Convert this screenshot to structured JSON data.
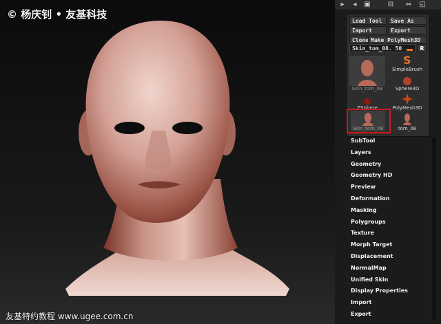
{
  "watermark": {
    "top": "© 杨庆钊 • 友基科技",
    "bottom": "友基特约教程 www.ugee.com.cn"
  },
  "toolbar_icons": [
    "toolbar-icon-a",
    "toolbar-icon-b",
    "toolbar-icon-c",
    "toolbar-icon-d",
    "toolbar-icon-e",
    "toolbar-icon-f"
  ],
  "tool_panel": {
    "buttons": {
      "load_tool": "Load Tool",
      "save_as": "Save As",
      "import": "Import",
      "export": "Export",
      "clone": "Clone",
      "make_polymesh": "Make PolyMesh3D"
    },
    "slider": {
      "label": "Skin_tom_08. 50",
      "level": 0.5
    },
    "r_label": "R",
    "thumbnails": [
      {
        "label": "Skin_tom_08"
      },
      {
        "label": "SimpleBrush"
      },
      {
        "label": "Sphere3D"
      },
      {
        "label": "ZSphere"
      },
      {
        "label": "PolyMesh3D"
      },
      {
        "label": "Skin_tom_08"
      },
      {
        "label": "tom_08"
      }
    ]
  },
  "menu": [
    "SubTool",
    "Layers",
    "Geometry",
    "Geometry HD",
    "Preview",
    "Deformation",
    "Masking",
    "Polygroups",
    "Texture",
    "Morph Target",
    "Displacement",
    "NormalMap",
    "Unified Skin",
    "Display Properties",
    "Import",
    "Export"
  ],
  "colors": {
    "highlight": "#d01818",
    "accent": "#e8722a",
    "skin": "#c98f84"
  }
}
